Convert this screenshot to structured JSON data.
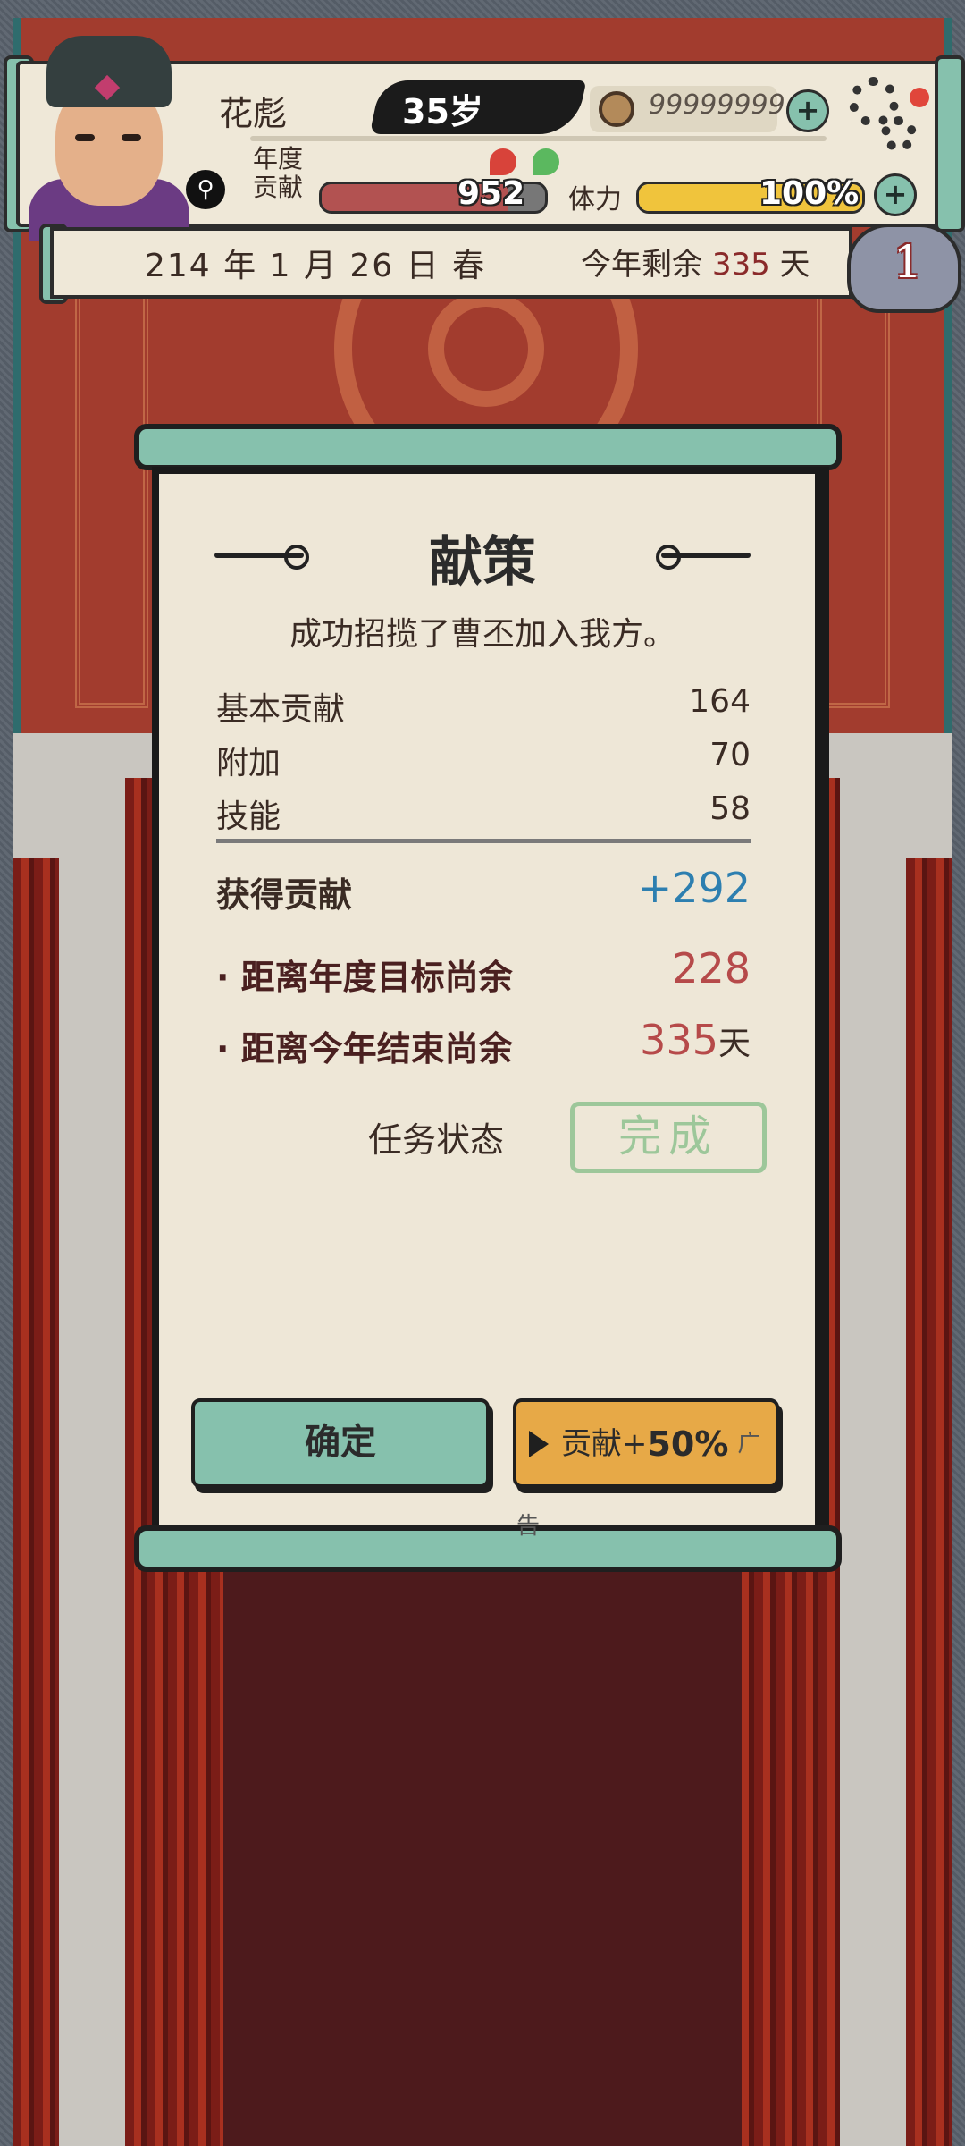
{
  "player": {
    "name": "花彪",
    "age": "35岁",
    "currency": "99999999",
    "annual_label_1": "年度",
    "annual_label_2": "贡献",
    "contribution": "952",
    "contribution_fill": 0.83,
    "stamina_label": "体力",
    "stamina": "100%",
    "stamina_fill": 1.0
  },
  "date": {
    "text": "214 年 1 月 26 日 春",
    "remain_prefix": "今年剩余",
    "remain_days": "335",
    "remain_suffix": "天",
    "badge": "1"
  },
  "dialog": {
    "title": "献策",
    "message": "成功招揽了曹丕加入我方。",
    "rows": [
      {
        "label": "基本贡献",
        "value": "164"
      },
      {
        "label": "附加",
        "value": "70"
      },
      {
        "label": "技能",
        "value": "58"
      }
    ],
    "gain_label": "获得贡献",
    "gain_value": "+292",
    "target_label": "距离年度目标尚余",
    "target_value": "228",
    "year_end_label": "距离今年结束尚余",
    "year_end_value": "335",
    "year_end_unit": "天",
    "status_label": "任务状态",
    "status_value": "完成",
    "confirm_button": "确定",
    "ad_button_label": "贡献+",
    "ad_button_pct": "50%",
    "ad_button_tag": "广告"
  },
  "colors": {
    "accent_teal": "#86c1ad",
    "wall_red": "#a23c2e",
    "gain_blue": "#2d7fb0",
    "remain_red": "#b64a4a",
    "ad_orange": "#e7a947"
  },
  "icons": [
    "search-icon",
    "coin-icon",
    "plus-icon",
    "gear-icon",
    "play-icon",
    "cloud-icon"
  ]
}
